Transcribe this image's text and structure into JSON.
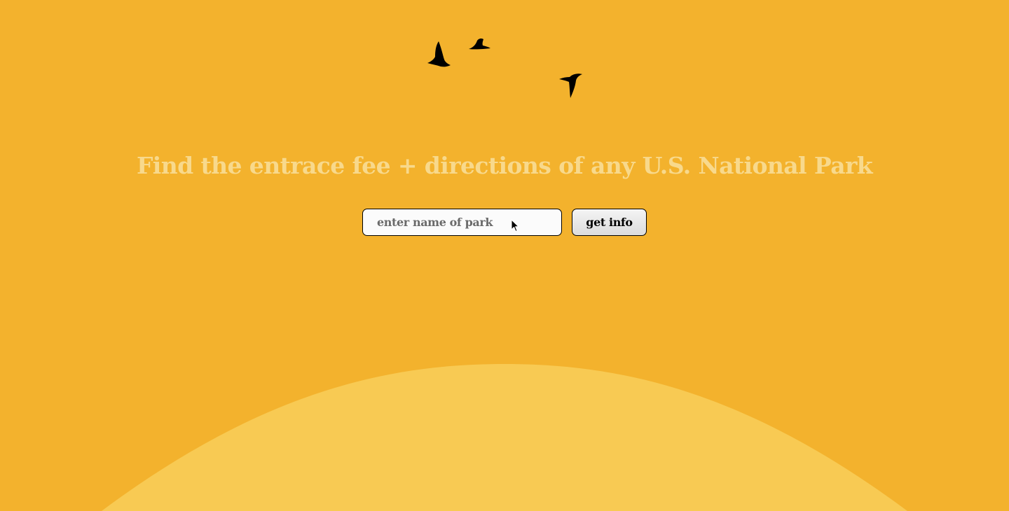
{
  "colors": {
    "background": "#f3b22d",
    "sun": "#f8ca53",
    "headline": "#f8d98c",
    "input_background": "#fbfbfb",
    "bird": "#000000"
  },
  "header": {
    "headline": "Find the entrace fee + directions of any U.S. National Park"
  },
  "search": {
    "placeholder": "enter name of park",
    "value": "",
    "button_label": "get info"
  },
  "decorations": {
    "icons": [
      "bird-icon",
      "bird-icon",
      "bird-icon",
      "mouse-cursor-icon"
    ]
  }
}
